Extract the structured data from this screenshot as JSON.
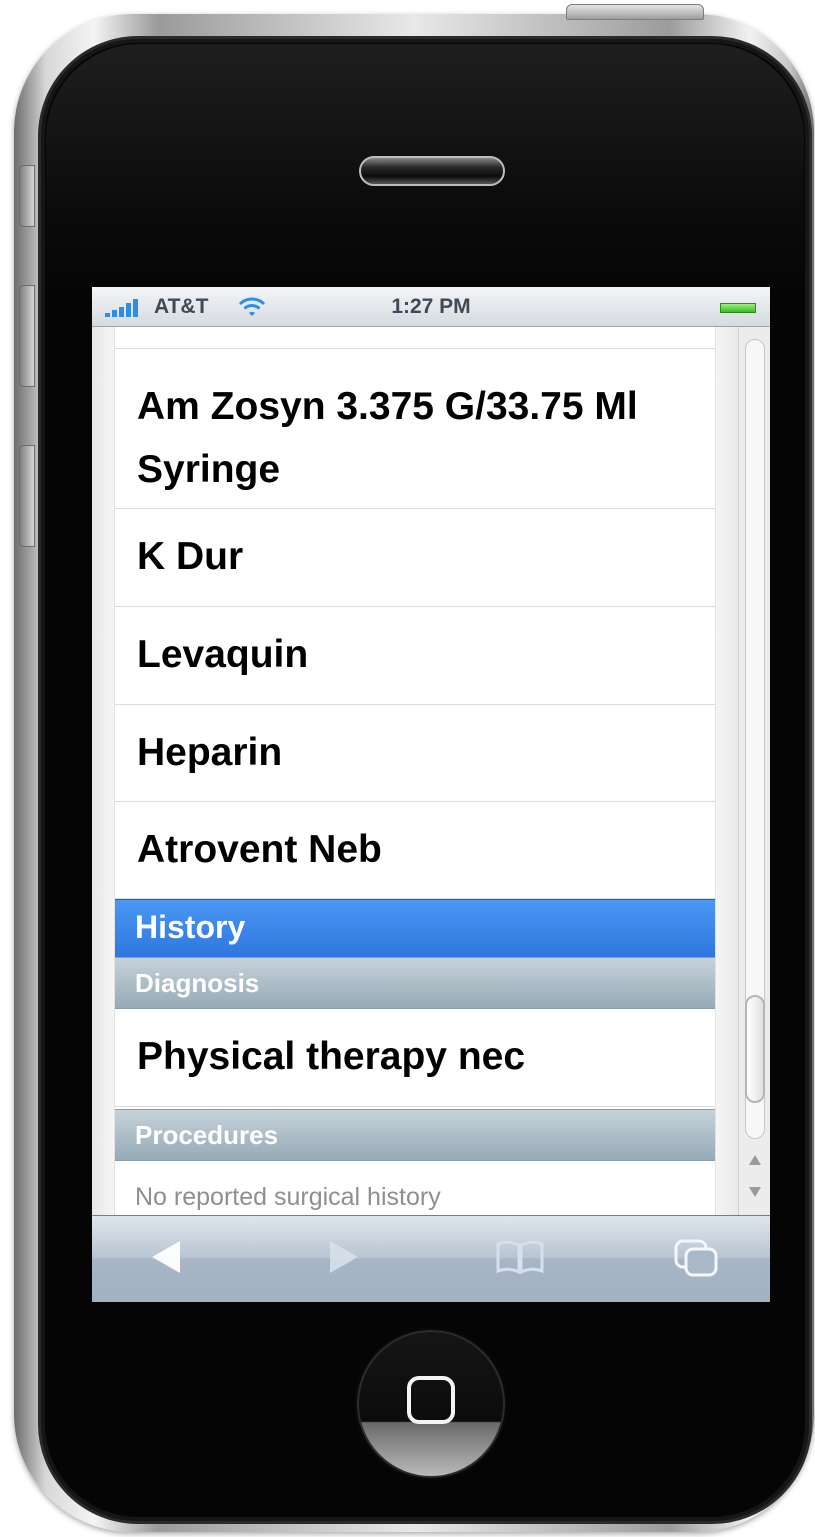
{
  "status_bar": {
    "carrier": "AT&T",
    "time": "1:27 PM",
    "signal_icon": "signal-bars-icon",
    "wifi_icon": "wifi-icon",
    "battery_icon": "battery-icon"
  },
  "medications": [
    {
      "label": "Am Zosyn 3.375 G/33.75 Ml Syringe"
    },
    {
      "label": "K Dur"
    },
    {
      "label": "Levaquin"
    },
    {
      "label": "Heparin"
    },
    {
      "label": "Atrovent Neb"
    }
  ],
  "history": {
    "header": "History",
    "diagnosis_header": "Diagnosis",
    "diagnosis_items": [
      {
        "label": "Physical therapy nec"
      }
    ],
    "procedures_header": "Procedures",
    "procedures_note": "No reported surgical history"
  },
  "toolbar": {
    "back_icon": "back-arrow-icon",
    "forward_icon": "forward-arrow-icon",
    "bookmarks_icon": "bookmarks-icon",
    "pages_icon": "pages-icon"
  },
  "colors": {
    "section_blue": "#3a86ea",
    "subsection_grey": "#a9b9c3",
    "status_blue": "#2c8ee8"
  }
}
